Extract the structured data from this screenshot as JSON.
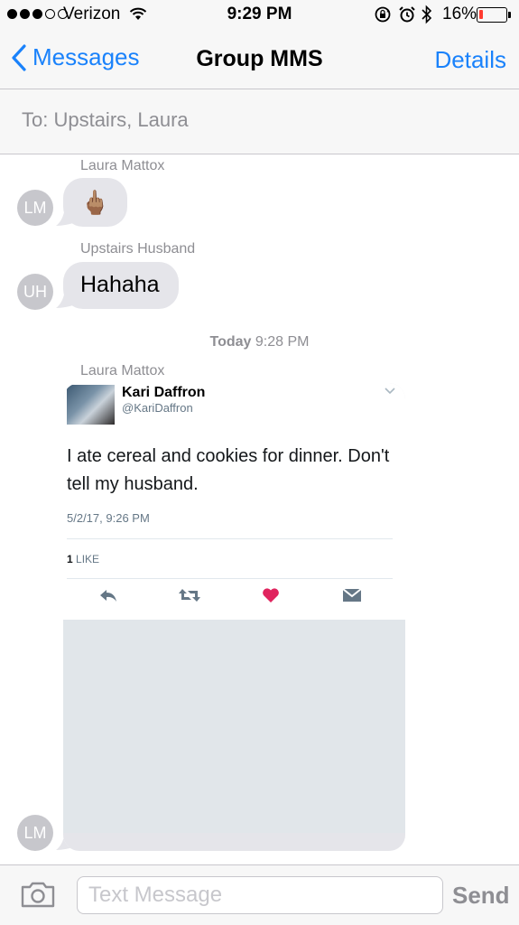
{
  "status_bar": {
    "carrier": "Verizon",
    "time": "9:29 PM",
    "battery_percent": "16%",
    "battery_level": 0.16,
    "signal_bars_filled": 3,
    "signal_bars_total": 5
  },
  "nav": {
    "back_label": "Messages",
    "title": "Group MMS",
    "details_label": "Details"
  },
  "to_field": {
    "text": "To: Upstairs, Laura"
  },
  "messages": [
    {
      "sender": "Laura Mattox",
      "initials": "LM",
      "body": "🖕🏽"
    },
    {
      "sender": "Upstairs Husband",
      "initials": "UH",
      "body": "Hahaha"
    }
  ],
  "timestamp": {
    "day": "Today",
    "time": "9:28 PM"
  },
  "tweet_message": {
    "sender": "Laura Mattox",
    "initials": "LM",
    "tweet": {
      "author": "Kari Daffron",
      "handle": "@KariDaffron",
      "text": "I ate cereal and cookies for dinner. Don't tell my husband.",
      "date": "5/2/17, 9:26 PM",
      "like_count": "1",
      "like_label": "LIKE"
    }
  },
  "input_bar": {
    "placeholder": "Text Message",
    "send_label": "Send"
  },
  "colors": {
    "ios_blue": "#1a82fb",
    "bubble_gray": "#e5e5ea",
    "avatar_gray": "#c7c7cc",
    "heart_pink": "#e0245e",
    "twitter_gray": "#657786"
  },
  "icons": [
    "wifi-icon",
    "lock-rotation-icon",
    "alarm-icon",
    "bluetooth-icon",
    "chevron-left-icon",
    "chevron-down-icon",
    "reply-icon",
    "retweet-icon",
    "heart-icon",
    "direct-message-icon",
    "camera-icon"
  ]
}
